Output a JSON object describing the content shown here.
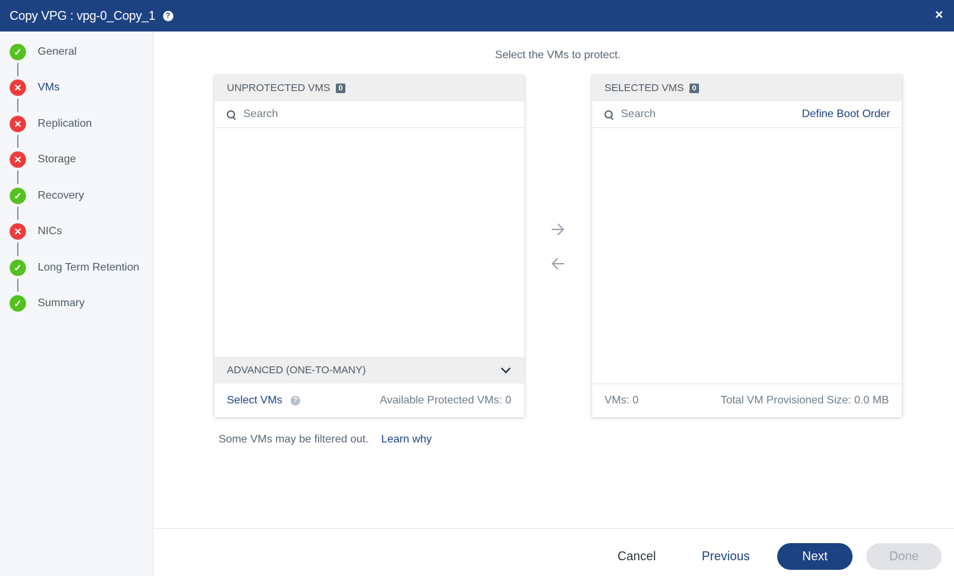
{
  "titlebar": {
    "title": "Copy VPG : vpg-0_Copy_1",
    "help": "?",
    "close": "×"
  },
  "steps": [
    {
      "label": "General",
      "status": "ok"
    },
    {
      "label": "VMs",
      "status": "error"
    },
    {
      "label": "Replication",
      "status": "error"
    },
    {
      "label": "Storage",
      "status": "error"
    },
    {
      "label": "Recovery",
      "status": "ok"
    },
    {
      "label": "NICs",
      "status": "error"
    },
    {
      "label": "Long Term Retention",
      "status": "ok"
    },
    {
      "label": "Summary",
      "status": "ok"
    }
  ],
  "main": {
    "instruction": "Select the VMs to protect.",
    "unprotected": {
      "title": "UNPROTECTED VMS",
      "count": "0",
      "search_placeholder": "Search",
      "advanced_label": "ADVANCED (ONE-TO-MANY)",
      "select_vms_label": "Select VMs",
      "available_label": "Available Protected VMs: 0"
    },
    "selected": {
      "title": "SELECTED VMS",
      "count": "0",
      "search_placeholder": "Search",
      "boot_order_label": "Define Boot Order",
      "vms_count_label": "VMs: 0",
      "total_size_label": "Total VM Provisioned Size: 0.0 MB"
    },
    "filtered_note": "Some VMs may be filtered out.",
    "learn_why": "Learn why"
  },
  "footer": {
    "cancel": "Cancel",
    "previous": "Previous",
    "next": "Next",
    "done": "Done"
  },
  "colors": {
    "brand": "#1c4282",
    "ok": "#53c21f",
    "error": "#ee3c3c"
  }
}
